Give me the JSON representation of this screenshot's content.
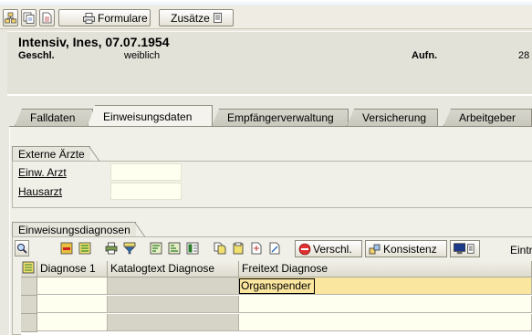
{
  "toolbar": {
    "formulare_label": "Formulare",
    "zusaetze_label": "Zusätze"
  },
  "header": {
    "patient": "Intensiv, Ines, 07.07.1954",
    "geschl_label": "Geschl.",
    "geschl_value": "weiblich",
    "aufn_label": "Aufn.",
    "aufn_value": "28"
  },
  "tabs": [
    {
      "label": "Falldaten",
      "active": false
    },
    {
      "label": "Einweisungsdaten",
      "active": true
    },
    {
      "label": "Empfängerverwaltung",
      "active": false
    },
    {
      "label": "Versicherung",
      "active": false
    },
    {
      "label": "Arbeitgeber",
      "active": false
    }
  ],
  "externe_aerzte": {
    "title": "Externe Ärzte",
    "einw_arzt_label": "Einw. Arzt",
    "einw_arzt_value": "",
    "hausarzt_label": "Hausarzt",
    "hausarzt_value": ""
  },
  "diagnosen": {
    "title": "Einweisungsdiagnosen",
    "verschl_label": "Verschl.",
    "konsistenz_label": "Konsistenz",
    "eintr_label": "Eintr"
  },
  "table": {
    "columns": [
      "Diagnose 1",
      "Katalogtext Diagnose",
      "Freitext Diagnose"
    ],
    "rows": [
      [
        "",
        "",
        "Organspender"
      ],
      [
        "",
        "",
        ""
      ],
      [
        "",
        "",
        ""
      ]
    ]
  },
  "colors": {
    "background": "#e9e8e0",
    "input_yellow": "#fffff0",
    "focus_row": "#fbe69f",
    "title_blue": "#6f8fc6"
  }
}
